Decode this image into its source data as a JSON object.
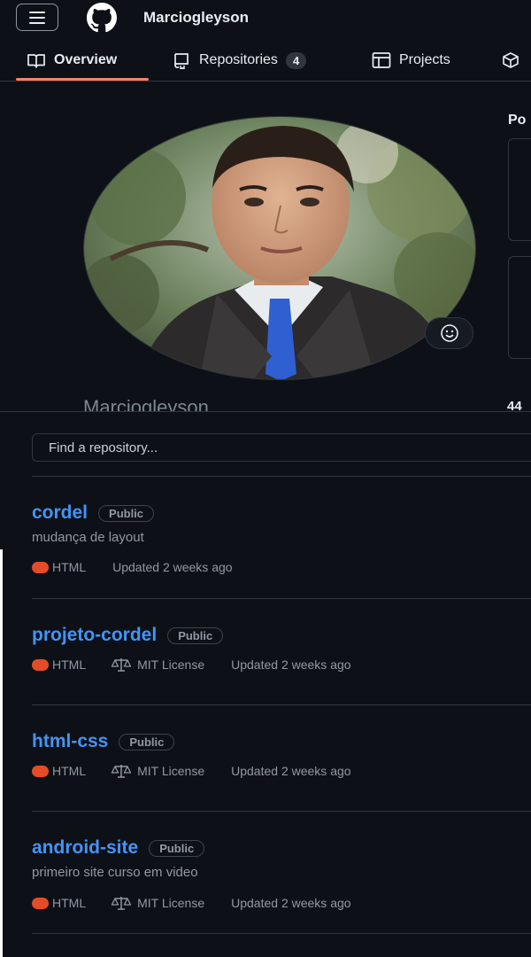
{
  "header": {
    "username": "Marciogleyson"
  },
  "tabs": [
    {
      "label": "Overview"
    },
    {
      "label": "Repositories",
      "count": "4"
    },
    {
      "label": "Projects"
    }
  ],
  "profile": {
    "display_name": "Marciogleyson",
    "side_title": "Po",
    "side_number": "44"
  },
  "search": {
    "placeholder": "Find a repository..."
  },
  "repos": [
    {
      "name": "cordel",
      "visibility": "Public",
      "description": "mudança de layout",
      "language": "HTML",
      "license": "",
      "updated": "Updated 2 weeks ago"
    },
    {
      "name": "projeto-cordel",
      "visibility": "Public",
      "description": "",
      "language": "HTML",
      "license": "MIT License",
      "updated": "Updated 2 weeks ago"
    },
    {
      "name": "html-css",
      "visibility": "Public",
      "description": "",
      "language": "HTML",
      "license": "MIT License",
      "updated": "Updated 2 weeks ago"
    },
    {
      "name": "android-site",
      "visibility": "Public",
      "description": "primeiro site curso em video",
      "language": "HTML",
      "license": "MIT License",
      "updated": "Updated 2 weeks ago"
    }
  ],
  "colors": {
    "accent_link": "#4493f8",
    "tab_underline": "#f78166",
    "html_lang": "#e34c26",
    "background": "#0d1117"
  }
}
